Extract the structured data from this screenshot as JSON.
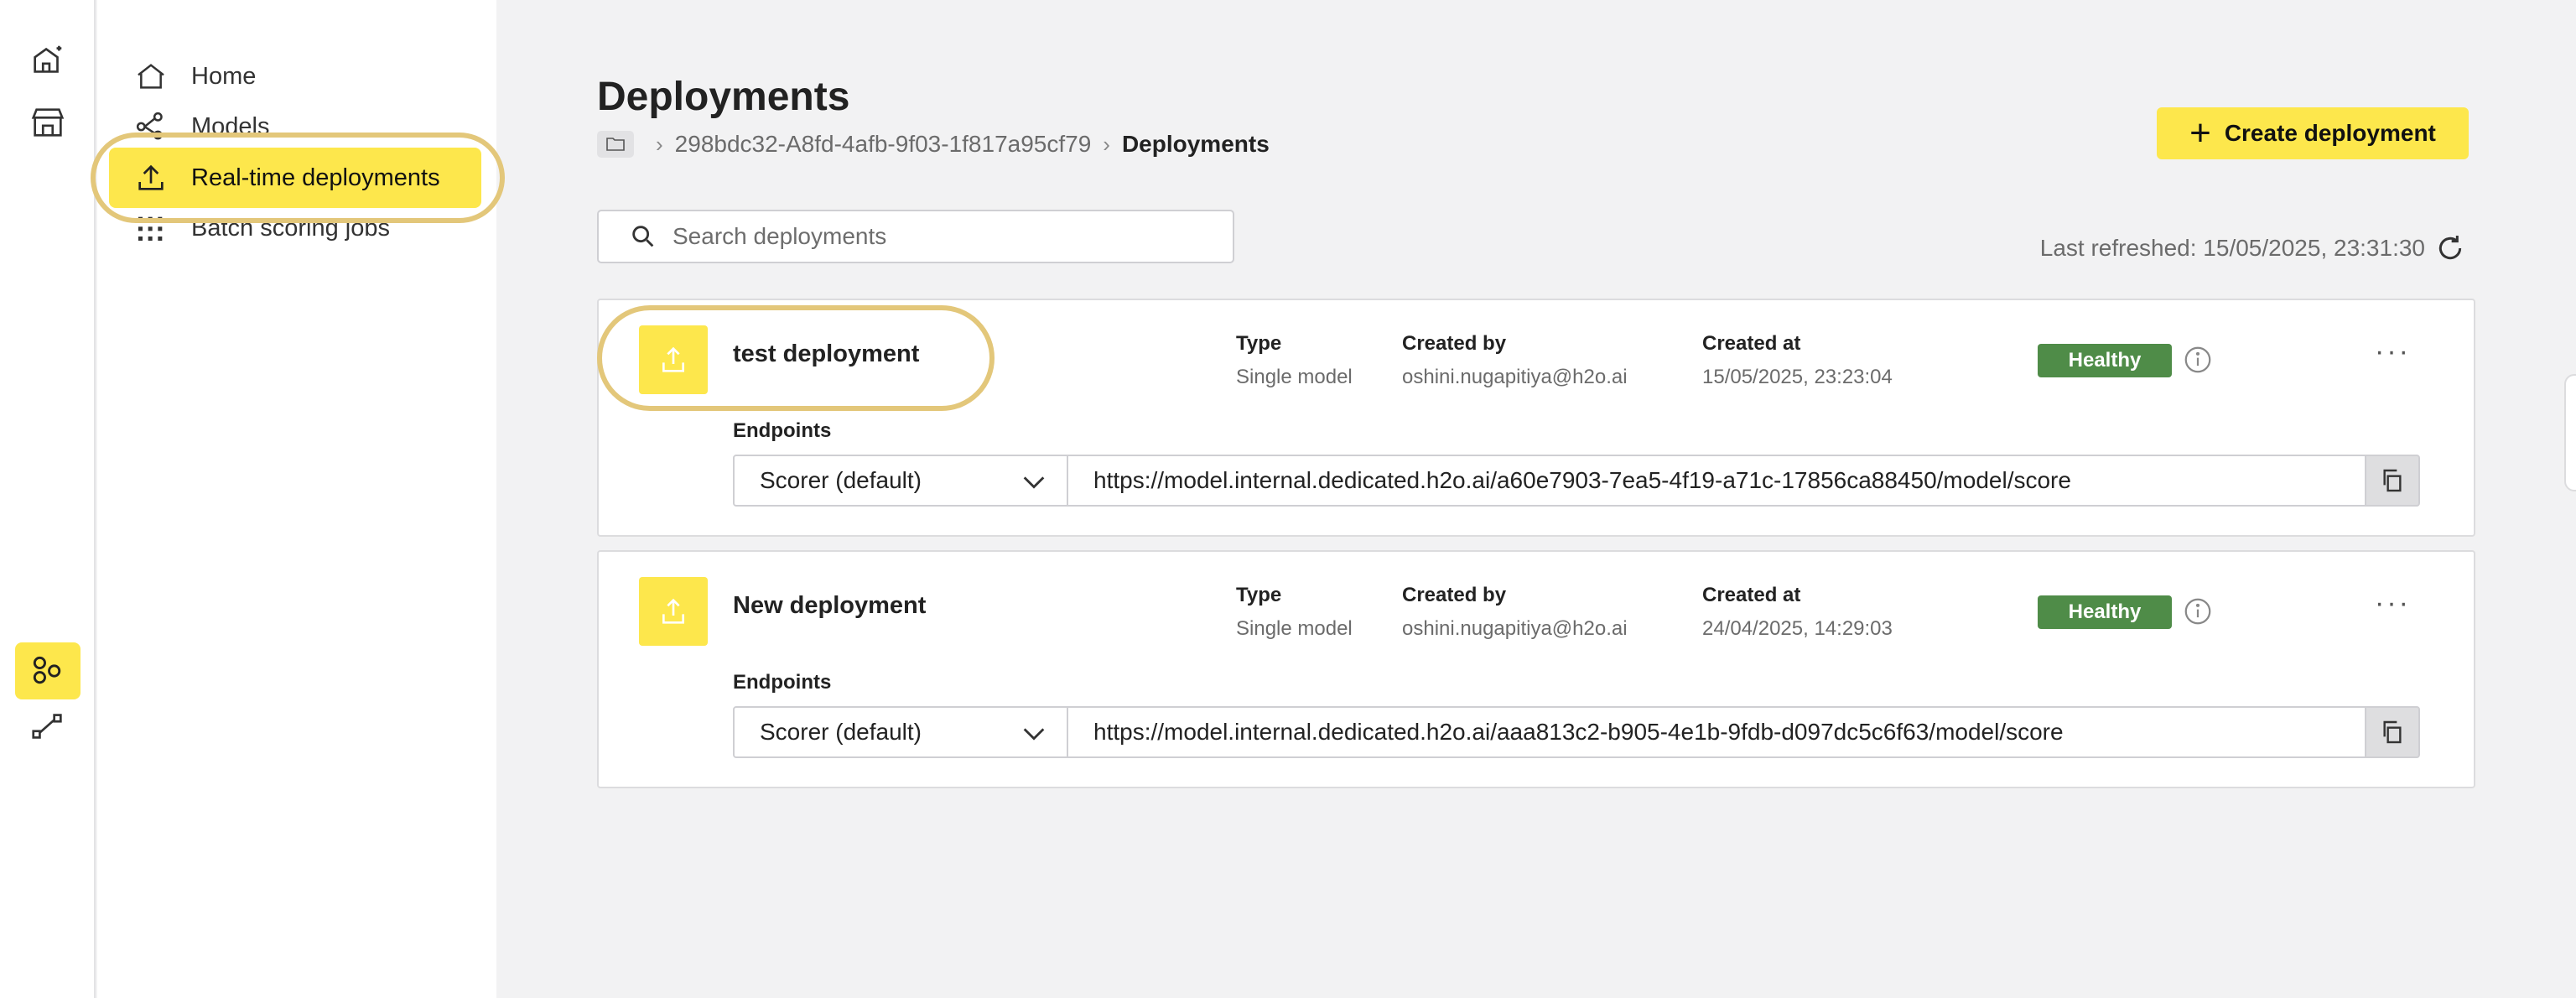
{
  "sidebar": {
    "items": [
      {
        "label": "Home",
        "icon": "home-icon"
      },
      {
        "label": "Models",
        "icon": "models-icon"
      },
      {
        "label": "Real-time deployments",
        "icon": "upload-icon"
      },
      {
        "label": "Batch scoring jobs",
        "icon": "grid-icon"
      }
    ],
    "active_item": "Real-time deployments"
  },
  "rail": {
    "icons": [
      "home-sparkle-icon",
      "store-icon",
      "models-app-icon",
      "pipeline-icon"
    ],
    "active_icon": "models-app-icon"
  },
  "main": {
    "title": "Deployments",
    "breadcrumb": {
      "folder_icon": "folder-icon",
      "project": "298bdc32-A8fd-4afb-9f03-1f817a95cf79",
      "current": "Deployments"
    },
    "create_button": "Create deployment",
    "search": {
      "placeholder": "Search deployments",
      "value": ""
    },
    "last_refreshed": "Last refreshed: 15/05/2025, 23:31:30"
  },
  "labels": {
    "type": "Type",
    "created_by": "Created by",
    "created_at": "Created at",
    "endpoints": "Endpoints"
  },
  "deployments": [
    {
      "name": "test deployment",
      "type": "Single model",
      "created_by": "oshini.nugapitiya@h2o.ai",
      "created_at": "15/05/2025, 23:23:04",
      "status": "Healthy",
      "scorer": "Scorer (default)",
      "endpoint_url": "https://model.internal.dedicated.h2o.ai/a60e7903-7ea5-4f19-a71c-17856ca88450/model/score"
    },
    {
      "name": "New deployment",
      "type": "Single model",
      "created_by": "oshini.nugapitiya@h2o.ai",
      "created_at": "24/04/2025, 14:29:03",
      "status": "Healthy",
      "scorer": "Scorer (default)",
      "endpoint_url": "https://model.internal.dedicated.h2o.ai/aaa813c2-b905-4e1b-9fdb-d097dc5c6f63/model/score"
    }
  ],
  "colors": {
    "accent": "#fde74c",
    "healthy": "#4f8c48",
    "highlight_ring": "#e3c77a"
  }
}
